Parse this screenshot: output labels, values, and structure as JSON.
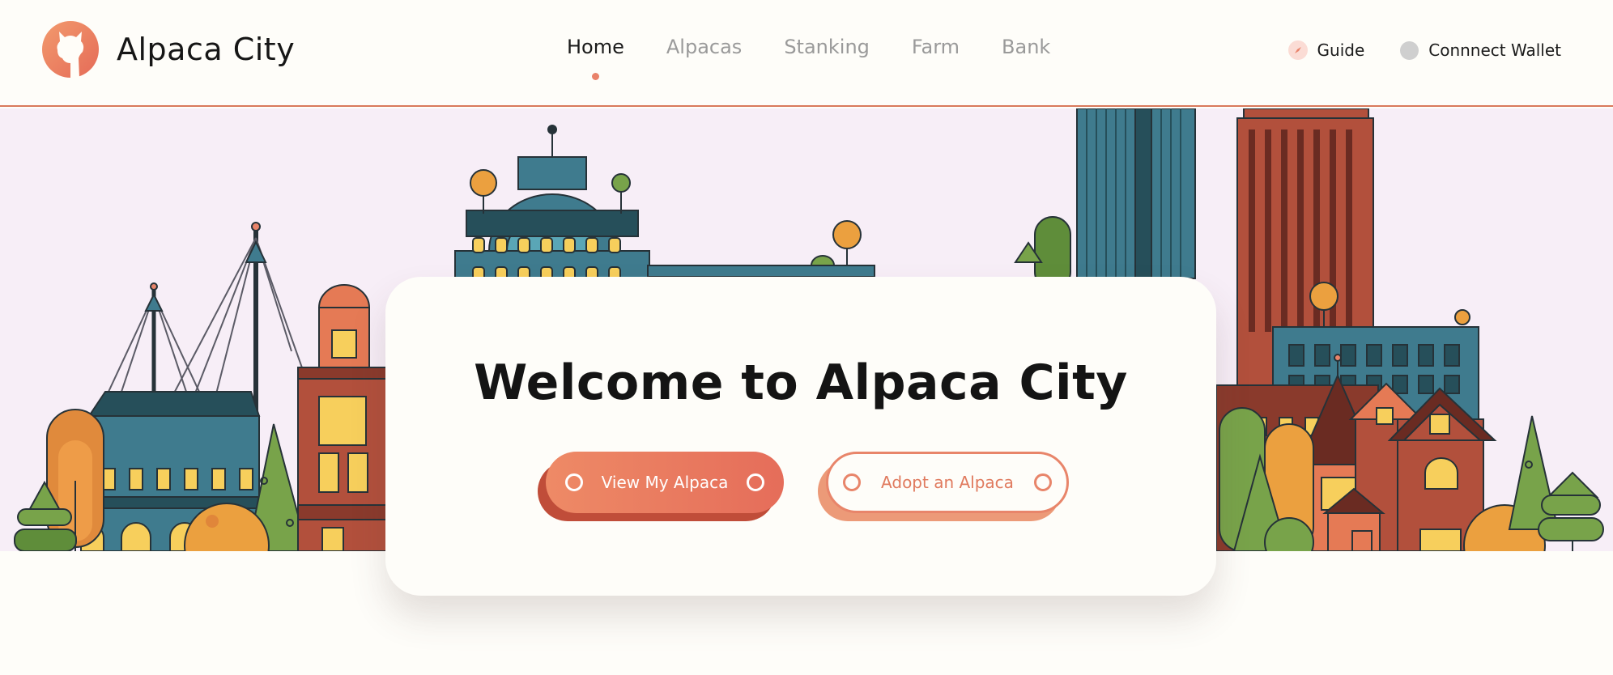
{
  "header": {
    "brand_name": "Alpaca City",
    "logo_icon": "alpaca-head-icon",
    "nav": [
      {
        "label": "Home",
        "active": true
      },
      {
        "label": "Alpacas",
        "active": false
      },
      {
        "label": "Stanking",
        "active": false
      },
      {
        "label": "Farm",
        "active": false
      },
      {
        "label": "Bank",
        "active": false
      }
    ],
    "guide_label": "Guide",
    "guide_icon": "compass-icon",
    "wallet_label": "Connnect Wallet",
    "wallet_icon": "wallet-status-dot-icon"
  },
  "hero": {
    "illustration": "city-skyline-illustration",
    "title": "Welcome to Alpaca City",
    "primary_button": "View My Alpaca",
    "secondary_button": "Adopt an Alpaca"
  },
  "colors": {
    "accent": "#e9826a",
    "primary_button": "#e56d5a",
    "hero_background": "#f7eef7",
    "page_background": "#fefdf9",
    "header_border": "#d9795b"
  }
}
